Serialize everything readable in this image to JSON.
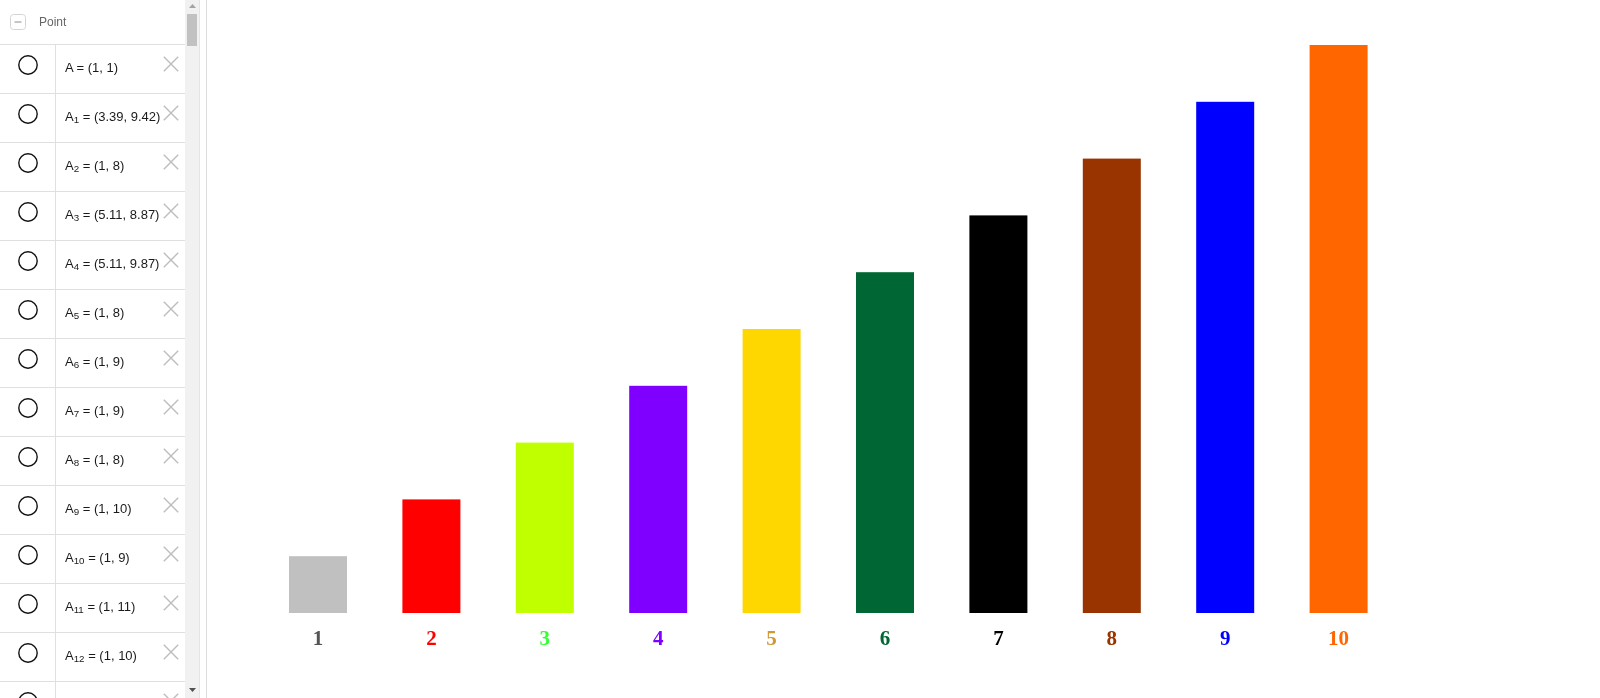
{
  "algebra_view": {
    "group": {
      "label": "Point",
      "expanded": true
    },
    "rows": [
      {
        "label": "A = (1, 1)",
        "visible": false
      },
      {
        "label": "A$_{1}$ = (3.39, 9.42)",
        "visible": false
      },
      {
        "label": "A$_{2}$ = (1, 8)",
        "visible": false
      },
      {
        "label": "A$_{3}$ = (5.11, 8.87)",
        "visible": false
      },
      {
        "label": "A$_{4}$ = (5.11, 9.87)",
        "visible": false
      },
      {
        "label": "A$_{5}$ = (1, 8)",
        "visible": false
      },
      {
        "label": "A$_{6}$ = (1, 9)",
        "visible": false
      },
      {
        "label": "A$_{7}$ = (1, 9)",
        "visible": false
      },
      {
        "label": "A$_{8}$ = (1, 8)",
        "visible": false
      },
      {
        "label": "A$_{9}$ = (1, 10)",
        "visible": false
      },
      {
        "label": "A$_{10}$ = (1, 9)",
        "visible": false
      },
      {
        "label": "A$_{11}$ = (1, 11)",
        "visible": false
      },
      {
        "label": "A$_{12}$ = (1, 10)",
        "visible": false
      },
      {
        "visible": false
      }
    ]
  },
  "graphics_view": {
    "bars": [
      {
        "color": "#c0c0c0",
        "label": {
          "text": "1",
          "color": "#555555"
        }
      },
      {
        "color": "#ff0000",
        "label": {
          "text": "2",
          "color": "#ff0000"
        }
      },
      {
        "color": "#bfff00",
        "label": {
          "text": "3",
          "color": "#33ff33"
        }
      },
      {
        "color": "#8000ff",
        "label": {
          "text": "4",
          "color": "#7f00ff"
        }
      },
      {
        "color": "#ffd700",
        "label": {
          "text": "5",
          "color": "#cc9933"
        }
      },
      {
        "color": "#006633",
        "label": {
          "text": "6",
          "color": "#006633"
        }
      },
      {
        "color": "#000000",
        "label": {
          "text": "7",
          "color": "#000000"
        }
      },
      {
        "color": "#993300",
        "label": {
          "text": "8",
          "color": "#993300"
        }
      },
      {
        "color": "#0000ff",
        "label": {
          "text": "9",
          "color": "#0000ff"
        }
      },
      {
        "color": "#ff6600",
        "label": {
          "text": "10",
          "color": "#ff6600"
        }
      }
    ]
  }
}
